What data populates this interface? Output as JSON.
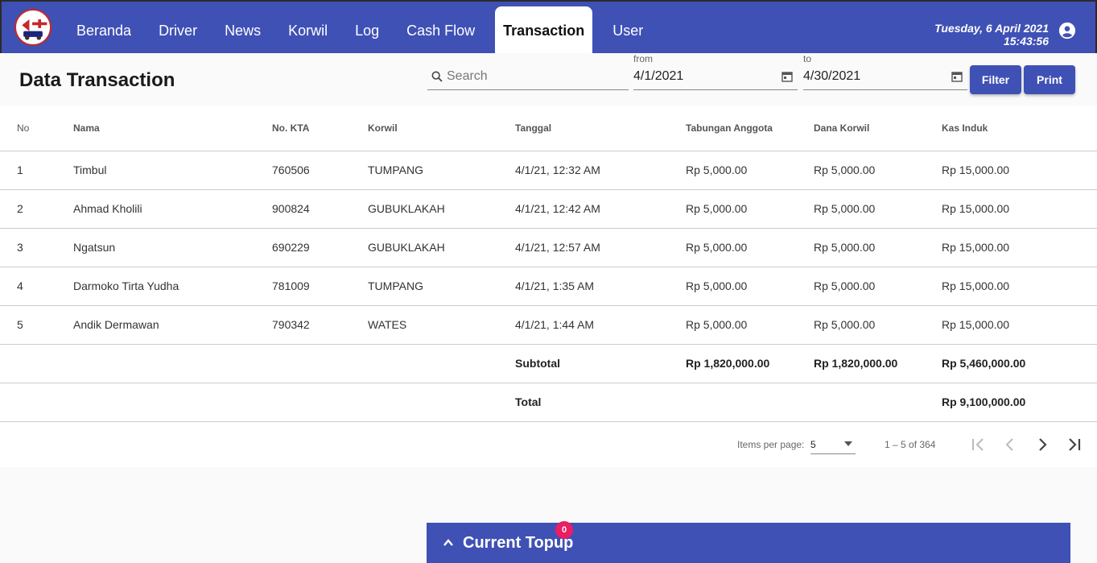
{
  "app": {
    "logo_icon": "app-logo-icon"
  },
  "nav": {
    "items": [
      "Beranda",
      "Driver",
      "News",
      "Korwil",
      "Log",
      "Cash Flow",
      "Transaction",
      "User"
    ],
    "active": "Transaction"
  },
  "datetime": {
    "date": "Tuesday, 6 April 2021",
    "time": "15:43:56"
  },
  "page": {
    "title": "Data Transaction"
  },
  "search": {
    "placeholder": "Search",
    "value": ""
  },
  "date_from": {
    "label": "from",
    "value": "4/1/2021"
  },
  "date_to": {
    "label": "to",
    "value": "4/30/2021"
  },
  "buttons": {
    "filter": "Filter",
    "print": "Print"
  },
  "table": {
    "headers": [
      "No",
      "Nama",
      "No. KTA",
      "Korwil",
      "Tanggal",
      "Tabungan Anggota",
      "Dana Korwil",
      "Kas Induk"
    ],
    "rows": [
      [
        "1",
        "Timbul",
        "760506",
        "TUMPANG",
        "4/1/21, 12:32 AM",
        "Rp 5,000.00",
        "Rp 5,000.00",
        "Rp 15,000.00"
      ],
      [
        "2",
        "Ahmad Kholili",
        "900824",
        "GUBUKLAKAH",
        "4/1/21, 12:42 AM",
        "Rp 5,000.00",
        "Rp 5,000.00",
        "Rp 15,000.00"
      ],
      [
        "3",
        "Ngatsun",
        "690229",
        "GUBUKLAKAH",
        "4/1/21, 12:57 AM",
        "Rp 5,000.00",
        "Rp 5,000.00",
        "Rp 15,000.00"
      ],
      [
        "4",
        "Darmoko Tirta Yudha",
        "781009",
        "TUMPANG",
        "4/1/21, 1:35 AM",
        "Rp 5,000.00",
        "Rp 5,000.00",
        "Rp 15,000.00"
      ],
      [
        "5",
        "Andik Dermawan",
        "790342",
        "WATES",
        "4/1/21, 1:44 AM",
        "Rp 5,000.00",
        "Rp 5,000.00",
        "Rp 15,000.00"
      ]
    ],
    "subtotal": {
      "label": "Subtotal",
      "tabungan": "Rp 1,820,000.00",
      "dana": "Rp 1,820,000.00",
      "kas": "Rp 5,460,000.00"
    },
    "total": {
      "label": "Total",
      "kas": "Rp 9,100,000.00"
    }
  },
  "paginator": {
    "items_per_page_label": "Items per page:",
    "page_size": "5",
    "range": "1 – 5 of 364"
  },
  "topup": {
    "label": "Current Topup",
    "badge": "0"
  },
  "colors": {
    "primary": "#3f51b5",
    "badge": "#e91e63"
  }
}
